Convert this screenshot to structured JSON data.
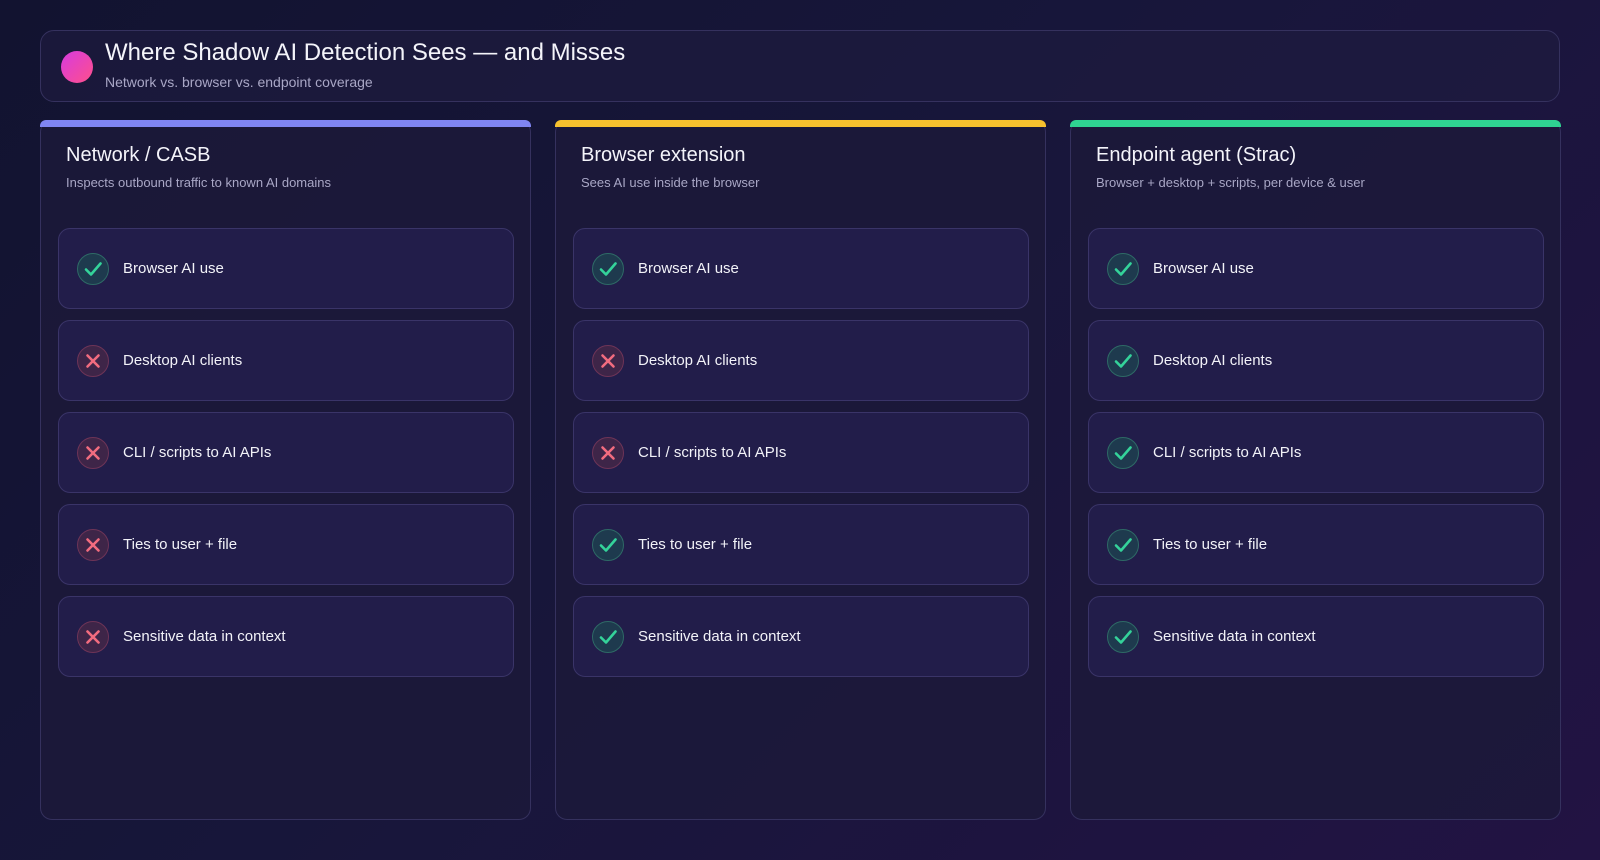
{
  "header": {
    "title": "Where Shadow AI Detection Sees — and Misses",
    "subtitle": "Network vs. browser vs. endpoint coverage"
  },
  "colors": {
    "check": "#34d39a",
    "cross": "#f26c7f",
    "network_accent": "#8085f2",
    "browser_accent": "#f7c12e",
    "endpoint_accent": "#2fd391"
  },
  "columns": [
    {
      "title": "Network / CASB",
      "subtitle": "Inspects outbound traffic to known AI domains",
      "accent": "#8085f2",
      "items": [
        {
          "label": "Browser AI use",
          "status": "check"
        },
        {
          "label": "Desktop AI clients",
          "status": "cross"
        },
        {
          "label": "CLI / scripts to AI APIs",
          "status": "cross"
        },
        {
          "label": "Ties to user + file",
          "status": "cross"
        },
        {
          "label": "Sensitive data in context",
          "status": "cross"
        }
      ]
    },
    {
      "title": "Browser extension",
      "subtitle": "Sees AI use inside the browser",
      "accent": "#f7c12e",
      "items": [
        {
          "label": "Browser AI use",
          "status": "check"
        },
        {
          "label": "Desktop AI clients",
          "status": "cross"
        },
        {
          "label": "CLI / scripts to AI APIs",
          "status": "cross"
        },
        {
          "label": "Ties to user + file",
          "status": "check"
        },
        {
          "label": "Sensitive data in context",
          "status": "check"
        }
      ]
    },
    {
      "title": "Endpoint agent (Strac)",
      "subtitle": "Browser + desktop + scripts, per device & user",
      "accent": "#2fd391",
      "items": [
        {
          "label": "Browser AI use",
          "status": "check"
        },
        {
          "label": "Desktop AI clients",
          "status": "check"
        },
        {
          "label": "CLI / scripts to AI APIs",
          "status": "check"
        },
        {
          "label": "Ties to user + file",
          "status": "check"
        },
        {
          "label": "Sensitive data in context",
          "status": "check"
        }
      ]
    }
  ]
}
